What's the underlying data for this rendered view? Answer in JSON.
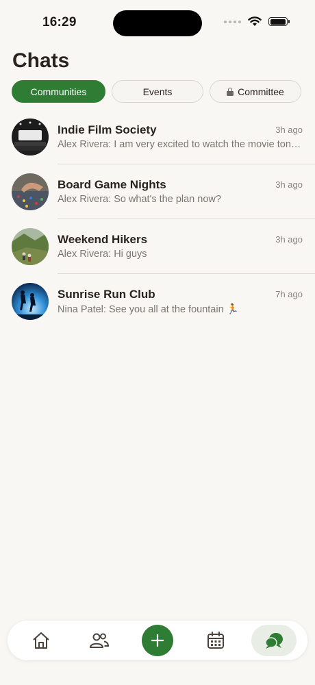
{
  "status_bar": {
    "time": "16:29"
  },
  "header": {
    "title": "Chats"
  },
  "tabs": [
    {
      "label": "Communities",
      "active": true
    },
    {
      "label": "Events",
      "active": false
    },
    {
      "label": "Committee",
      "active": false,
      "icon": "lock-icon"
    }
  ],
  "chats": [
    {
      "name": "Indie Film Society",
      "time": "3h ago",
      "preview": "Alex Rivera: I am very excited to watch the movie tonight",
      "avatar": "cinema-photo"
    },
    {
      "name": "Board Game Nights",
      "time": "3h ago",
      "preview": "Alex Rivera: So what's the plan now?",
      "avatar": "board-game-photo"
    },
    {
      "name": "Weekend Hikers",
      "time": "3h ago",
      "preview": "Alex Rivera: Hi guys",
      "avatar": "hikers-photo"
    },
    {
      "name": "Sunrise Run Club",
      "time": "7h ago",
      "preview": "Nina Patel: See you all at the fountain 🏃",
      "avatar": "runners-photo"
    }
  ],
  "bottom_nav": {
    "items": [
      "home-icon",
      "people-icon",
      "plus-icon",
      "calendar-icon",
      "chat-bubbles-icon"
    ],
    "active": "chat-bubbles-icon"
  },
  "colors": {
    "accent": "#2f7d35",
    "background": "#f8f7f4"
  }
}
